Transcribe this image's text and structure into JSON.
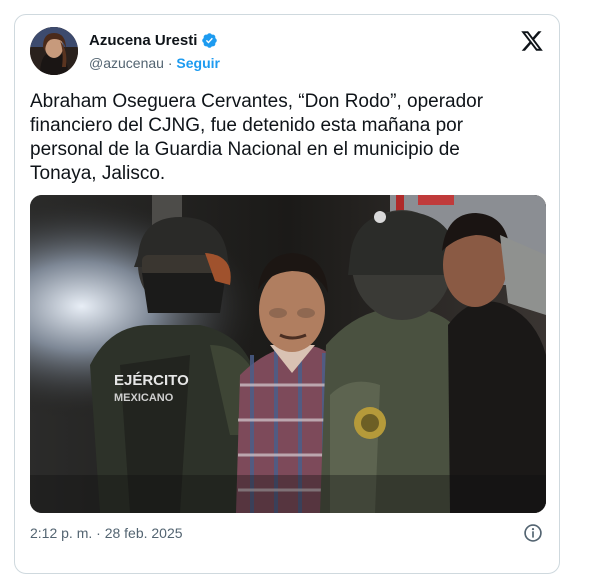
{
  "author": {
    "name": "Azucena Uresti",
    "handle": "@azucenau",
    "separator": " · ",
    "follow_label": "Seguir"
  },
  "tweet": {
    "text": "Abraham Oseguera Cervantes, “Don Rodo”, operador financiero del CJNG, fue detenido esta mañana por personal de la Guardia Nacional en el municipio de Tonaya, Jalisco."
  },
  "photo": {
    "vest_text_line1": "EJÉRCITO",
    "vest_text_line2": "MEXICANO"
  },
  "footer": {
    "timestamp": "2:12 p. m. · 28 feb. 2025"
  },
  "icons": {
    "verified": "verified-badge-icon",
    "platform": "x-logo-icon",
    "info": "info-icon"
  },
  "colors": {
    "accent": "#1d9bf0",
    "text": "#0f1419",
    "muted": "#536471",
    "border": "#cfd9de"
  }
}
